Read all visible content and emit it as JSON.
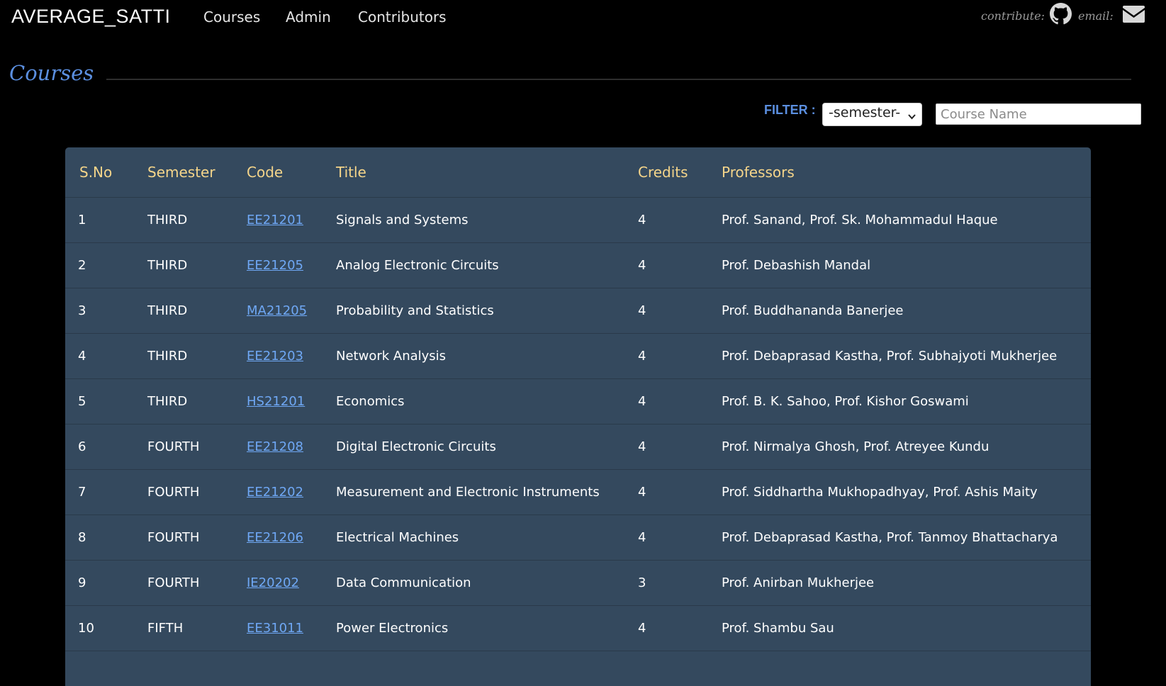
{
  "nav": {
    "brand": "AVERAGE_SATTI",
    "links": [
      "Courses",
      "Admin",
      "Contributors"
    ],
    "contribute_label": "contribute:",
    "email_label": "email:",
    "github_icon": "github-icon",
    "email_icon": "envelope-icon"
  },
  "page": {
    "title": "Courses"
  },
  "filter": {
    "label": "FILTER :",
    "semester_selected": "-semester-",
    "course_placeholder": "Course Name"
  },
  "table": {
    "headers": [
      "S.No",
      "Semester",
      "Code",
      "Title",
      "Credits",
      "Professors"
    ],
    "rows": [
      {
        "sno": "1",
        "semester": "THIRD",
        "code": "EE21201",
        "title": "Signals and Systems",
        "credits": "4",
        "professors": "Prof. Sanand, Prof. Sk. Mohammadul Haque"
      },
      {
        "sno": "2",
        "semester": "THIRD",
        "code": "EE21205",
        "title": "Analog Electronic Circuits",
        "credits": "4",
        "professors": "Prof. Debashish Mandal"
      },
      {
        "sno": "3",
        "semester": "THIRD",
        "code": "MA21205",
        "title": "Probability and Statistics",
        "credits": "4",
        "professors": "Prof. Buddhananda Banerjee"
      },
      {
        "sno": "4",
        "semester": "THIRD",
        "code": "EE21203",
        "title": "Network Analysis",
        "credits": "4",
        "professors": "Prof. Debaprasad Kastha, Prof. Subhajyoti Mukherjee"
      },
      {
        "sno": "5",
        "semester": "THIRD",
        "code": "HS21201",
        "title": "Economics",
        "credits": "4",
        "professors": "Prof. B. K. Sahoo, Prof. Kishor Goswami"
      },
      {
        "sno": "6",
        "semester": "FOURTH",
        "code": "EE21208",
        "title": "Digital Electronic Circuits",
        "credits": "4",
        "professors": "Prof. Nirmalya Ghosh, Prof. Atreyee Kundu"
      },
      {
        "sno": "7",
        "semester": "FOURTH",
        "code": "EE21202",
        "title": "Measurement and Electronic Instruments",
        "credits": "4",
        "professors": "Prof. Siddhartha Mukhopadhyay, Prof. Ashis Maity"
      },
      {
        "sno": "8",
        "semester": "FOURTH",
        "code": "EE21206",
        "title": "Electrical Machines",
        "credits": "4",
        "professors": "Prof. Debaprasad Kastha, Prof. Tanmoy Bhattacharya"
      },
      {
        "sno": "9",
        "semester": "FOURTH",
        "code": "IE20202",
        "title": "Data Communication",
        "credits": "3",
        "professors": "Prof. Anirban Mukherjee"
      },
      {
        "sno": "10",
        "semester": "FIFTH",
        "code": "EE31011",
        "title": "Power Electronics",
        "credits": "4",
        "professors": "Prof. Shambu Sau"
      }
    ]
  },
  "colors": {
    "background": "#000000",
    "accent": "#5b8fe0",
    "table_bg": "#34495e",
    "header_text": "#f5d58a",
    "link": "#6fa8f5"
  }
}
